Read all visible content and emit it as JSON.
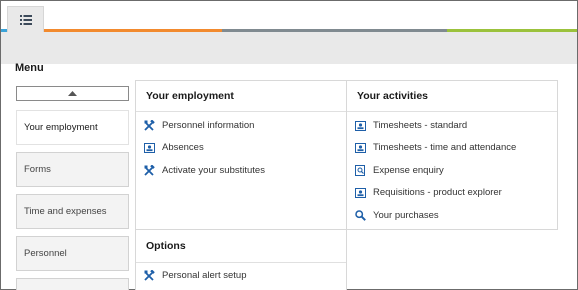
{
  "menu": {
    "title": "Menu"
  },
  "sidebar": {
    "items": [
      {
        "label": "Your employment"
      },
      {
        "label": "Forms"
      },
      {
        "label": "Time and expenses"
      },
      {
        "label": "Personnel"
      }
    ]
  },
  "employment": {
    "title": "Your employment",
    "links": [
      {
        "label": "Personnel information",
        "icon": "tools-icon"
      },
      {
        "label": "Absences",
        "icon": "id-card-icon"
      },
      {
        "label": "Activate your substitutes",
        "icon": "tools-icon"
      }
    ]
  },
  "activities": {
    "title": "Your activities",
    "links": [
      {
        "label": "Timesheets - standard",
        "icon": "id-card-icon"
      },
      {
        "label": "Timesheets - time and attendance",
        "icon": "id-card-icon"
      },
      {
        "label": "Expense enquiry",
        "icon": "document-search-icon"
      },
      {
        "label": "Requisitions - product explorer",
        "icon": "id-card-icon"
      },
      {
        "label": "Your purchases",
        "icon": "magnifier-icon"
      }
    ]
  },
  "options": {
    "title": "Options",
    "links": [
      {
        "label": "Personal alert setup",
        "icon": "tools-icon"
      }
    ]
  },
  "colors": {
    "stripe_blue": "#3aa3d8",
    "stripe_orange": "#f28a2e",
    "stripe_grey": "#808a90",
    "stripe_green": "#9bc23c",
    "icon_blue": "#1e5fa8"
  }
}
